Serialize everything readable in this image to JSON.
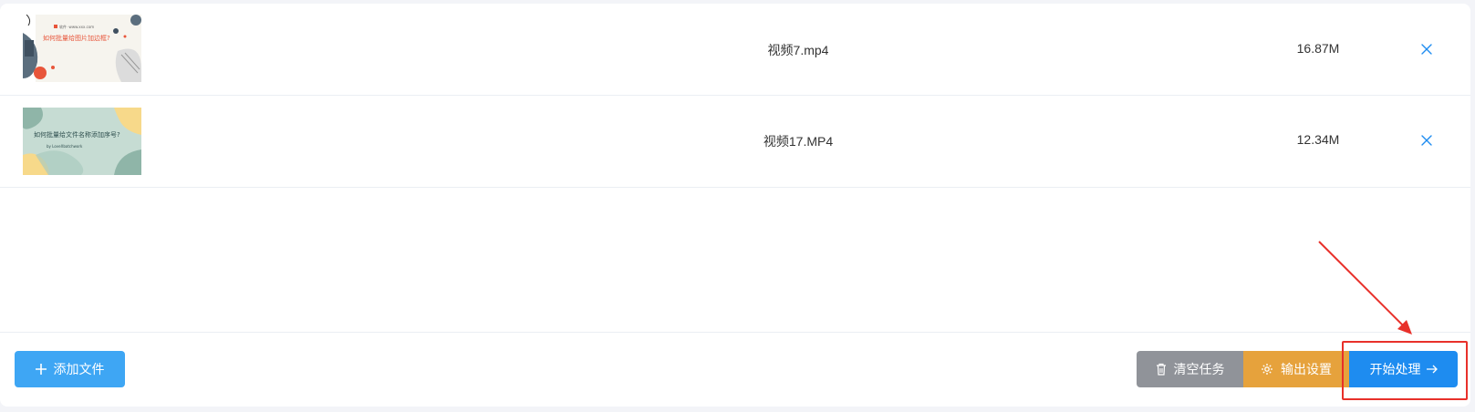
{
  "files": [
    {
      "name": "视频7.mp4",
      "size": "16.87M",
      "thumbnail_text": "如何批量给图片加边框?",
      "thumbnail_small_text": "软件 ·www.xxx.com"
    },
    {
      "name": "视频17.MP4",
      "size": "12.34M",
      "thumbnail_text": "如何批量给文件名称添加序号?",
      "thumbnail_small_text": "by LoveXbatchwork"
    }
  ],
  "toolbar": {
    "add_file": "添加文件",
    "clear_tasks": "清空任务",
    "output_settings": "输出设置",
    "start_processing": "开始处理"
  },
  "icons": {
    "add": "plus-icon",
    "clear": "trash-icon",
    "output": "gear-icon",
    "start": "arrow-right-icon",
    "remove": "close-icon"
  },
  "colors": {
    "add_button": "#3ea6f4",
    "clear_button": "#909399",
    "output_button": "#e6a23c",
    "start_button": "#1e8cf0",
    "remove_icon": "#1e8cf0",
    "annotation": "#e8302a"
  }
}
